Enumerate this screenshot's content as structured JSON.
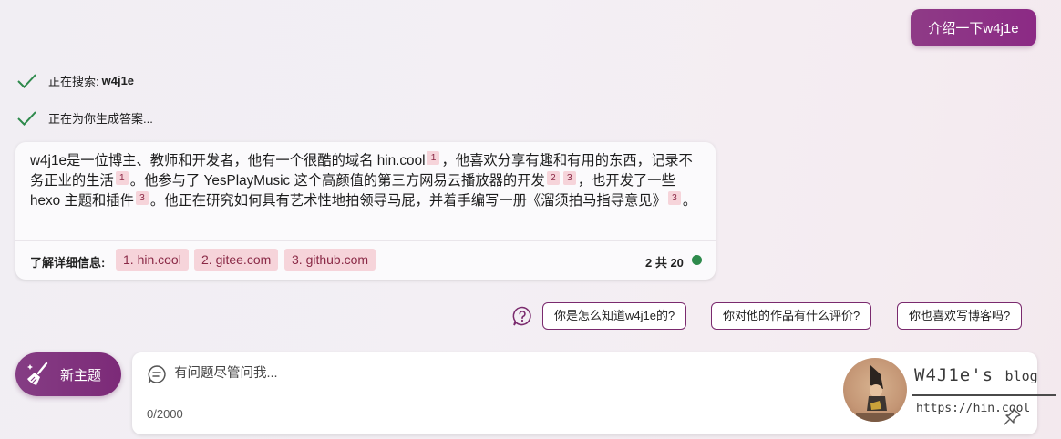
{
  "user_message": "介绍一下w4j1e",
  "status": {
    "searching_label": "正在搜索:",
    "searching_query": "w4j1e",
    "generating_label": "正在为你生成答案..."
  },
  "answer": {
    "p1": "w4j1e是一位博主、教师和开发者，他有一个很酷的域名 hin.cool",
    "c1": "1",
    "p2": "，他喜欢分享有趣和有用的东西，记录不务正业的生活",
    "c2": "1",
    "p3": "。他参与了 YesPlayMusic 这个高颜值的第三方网易云播放器的开发",
    "c3": "2",
    "c4": "3",
    "p4": "，也开发了一些 hexo 主题和插件",
    "c5": "3",
    "p5": "。他正在研究如何具有艺术性地拍领导马屁，并着手编写一册《溜须拍马指导意见》",
    "c6": "3",
    "p6": "。"
  },
  "sources": {
    "label": "了解详细信息:",
    "items": [
      "1. hin.cool",
      "2. gitee.com",
      "3. github.com"
    ],
    "count": "2 共 20",
    "count_dot_color": "#2e8a4c"
  },
  "suggestions": [
    "你是怎么知道w4j1e的?",
    "你对他的作品有什么评价?",
    "你也喜欢写博客吗?"
  ],
  "new_topic_label": "新主题",
  "input": {
    "placeholder": "有问题尽管问我...",
    "char_count": "0/2000"
  },
  "watermark": {
    "title_main": "W4J1e's",
    "title_small": "blog",
    "url": "https://hin.cool"
  },
  "colors": {
    "accent": "#8c2a85",
    "cite_bg": "#f6d4da",
    "cite_text": "#8a2946"
  }
}
